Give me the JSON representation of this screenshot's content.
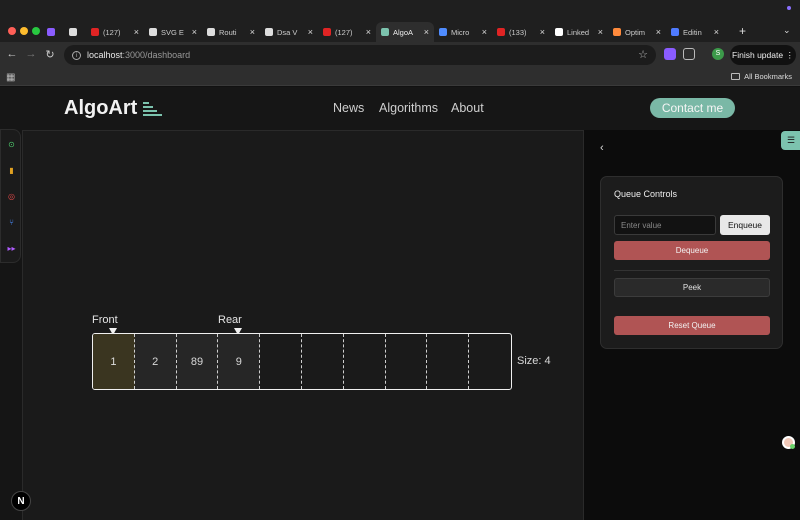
{
  "browser": {
    "tabs": [
      {
        "label": "",
        "icon": "podcast-icon",
        "color": "#8a5cff"
      },
      {
        "label": "",
        "icon": "github-icon",
        "color": "#dddddd"
      },
      {
        "label": "(127)",
        "icon": "youtube-icon",
        "color": "#e02424"
      },
      {
        "label": "SVG E",
        "icon": "globe-icon",
        "color": "#dddddd"
      },
      {
        "label": "Routi",
        "icon": "notion-icon",
        "color": "#dddddd"
      },
      {
        "label": "Dsa V",
        "icon": "notion-icon",
        "color": "#dddddd"
      },
      {
        "label": "(127)",
        "icon": "youtube-icon",
        "color": "#e02424"
      },
      {
        "label": "AlgoA",
        "icon": "algoart-icon",
        "color": "#7cc3ae"
      },
      {
        "label": "Micro",
        "icon": "microsoft-icon",
        "color": "#4f8cff"
      },
      {
        "label": "(133)",
        "icon": "youtube-icon",
        "color": "#e02424"
      },
      {
        "label": "Linked",
        "icon": "vercel-icon",
        "color": "#ffffff"
      },
      {
        "label": "Optim",
        "icon": "sun-icon",
        "color": "#ff8a3c"
      },
      {
        "label": "Editin",
        "icon": "gem-icon",
        "color": "#4f7bff"
      }
    ],
    "url_host": "localhost",
    "url_path": ":3000/dashboard",
    "finish_update": "Finish update",
    "all_bookmarks": "All Bookmarks",
    "profile_initial": "S"
  },
  "nav": {
    "logo": "AlgoArt",
    "links": [
      "News",
      "Algorithms",
      "About"
    ],
    "contact": "Contact me"
  },
  "queue": {
    "front_label": "Front",
    "rear_label": "Rear",
    "cells": [
      "1",
      "2",
      "89",
      "9",
      "",
      "",
      "",
      "",
      "",
      ""
    ],
    "front_index": 0,
    "rear_index": 3,
    "size_text": "Size: 4"
  },
  "panel": {
    "title": "Queue Controls",
    "input_placeholder": "Enter value",
    "enqueue": "Enqueue",
    "dequeue": "Dequeue",
    "peek": "Peek",
    "reset": "Reset Queue",
    "next_badge": "N"
  },
  "colors": {
    "accent": "#7cc3ae",
    "danger": "#b05454"
  }
}
